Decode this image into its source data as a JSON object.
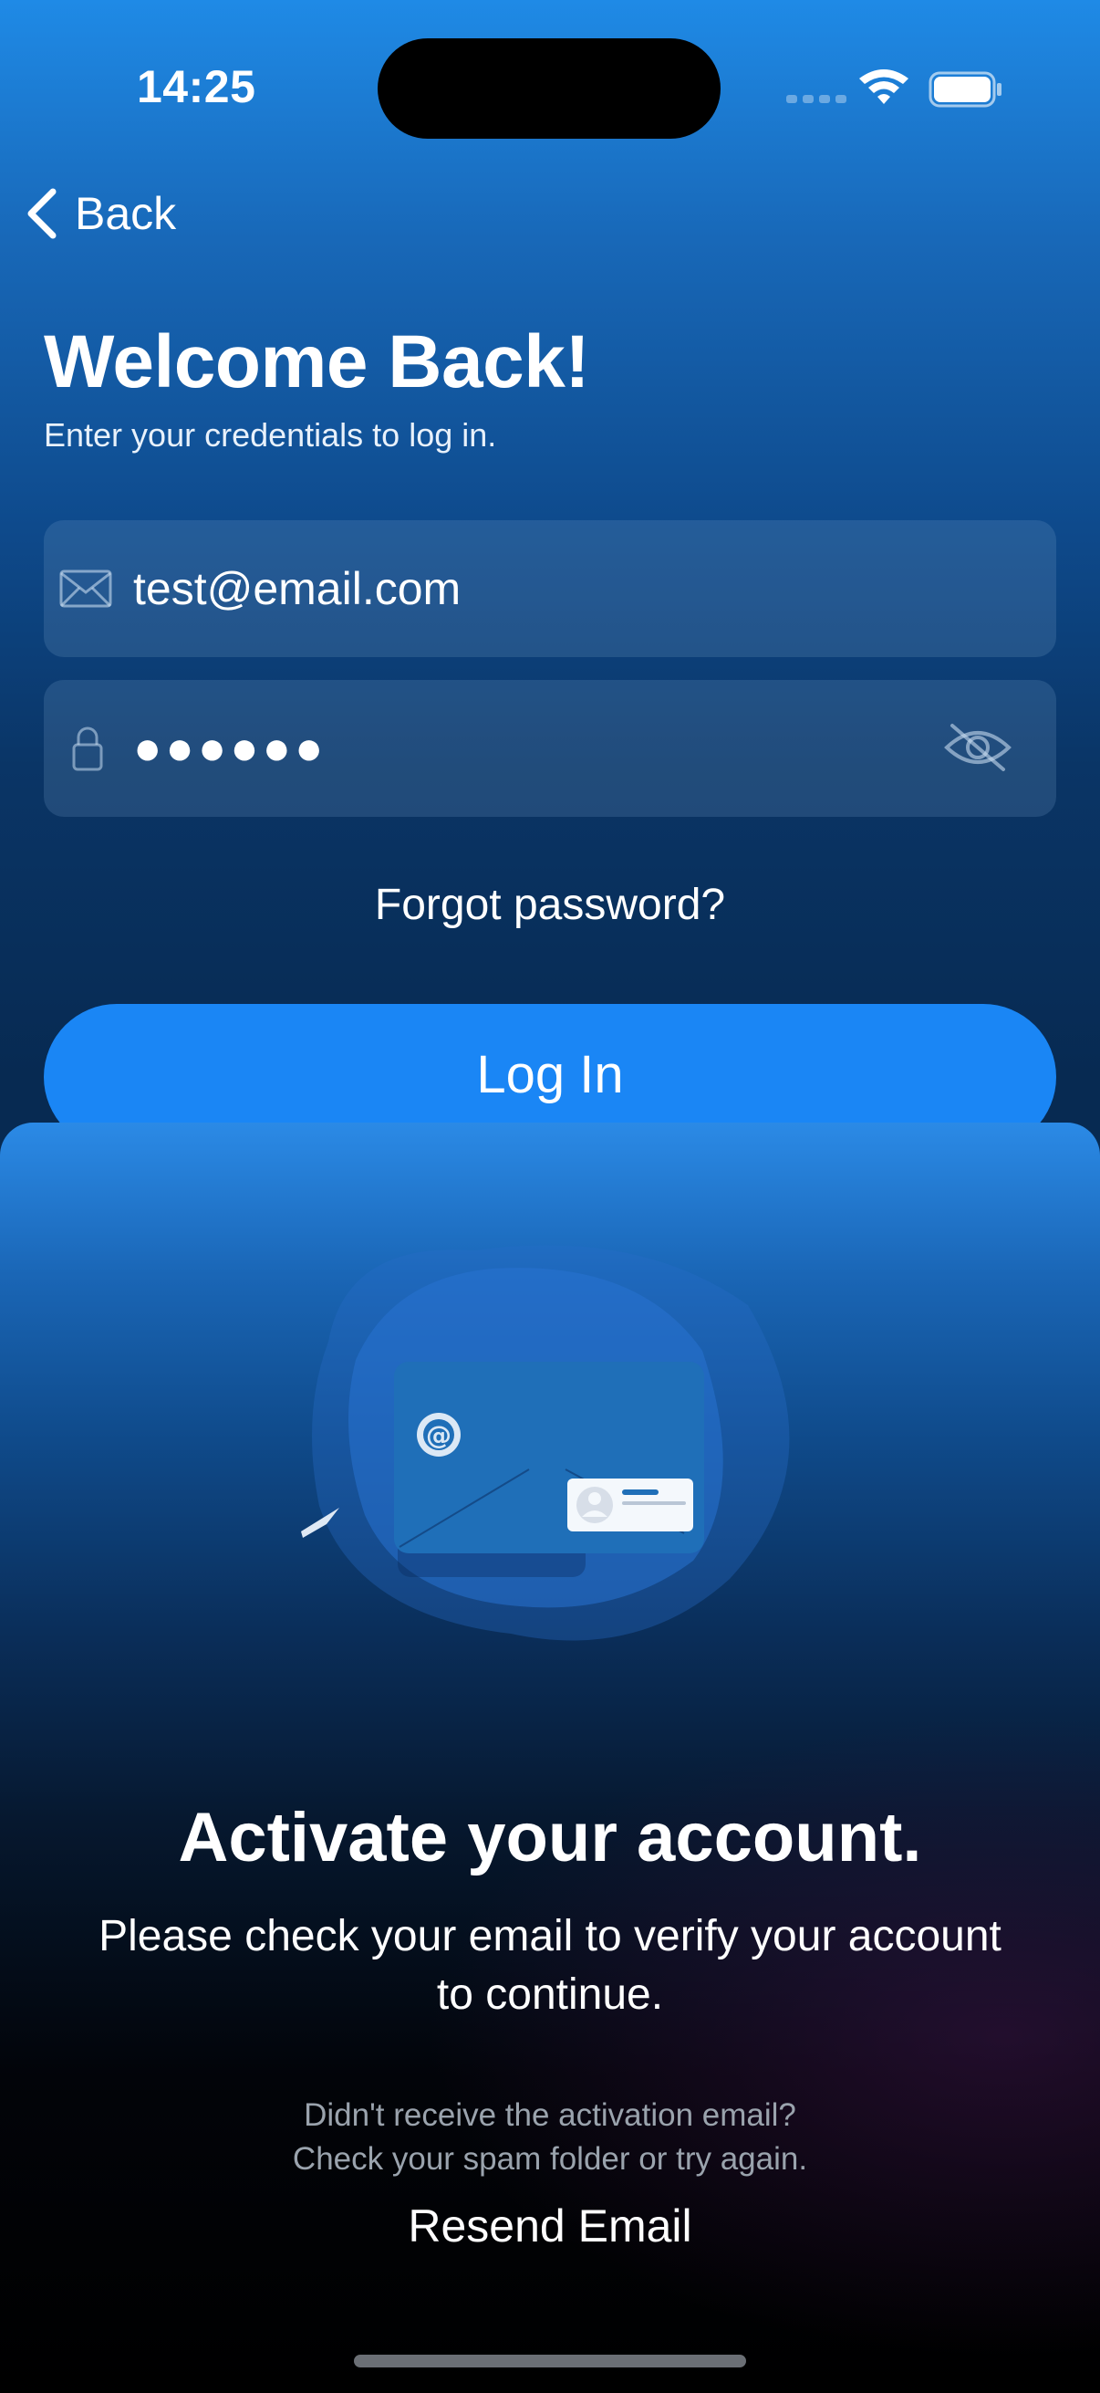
{
  "status_bar": {
    "time": "14:25"
  },
  "nav": {
    "back_label": "Back"
  },
  "login": {
    "title": "Welcome Back!",
    "subtitle": "Enter your credentials to log in.",
    "email_value": "test@email.com",
    "password_masked": "●●●●●●",
    "forgot_label": "Forgot password?",
    "login_label": "Log In"
  },
  "sheet": {
    "title": "Activate your account.",
    "body_line1": "Please check your email to verify your account",
    "body_line2": "to continue.",
    "hint_line1": "Didn't receive the activation email?",
    "hint_line2": "Check your spam folder or try again.",
    "resend_label": "Resend Email"
  },
  "colors": {
    "primary_button": "#1a86f5",
    "background_top": "#1f8ae6",
    "hint_text": "#9aa3ad"
  },
  "icons": {
    "back": "chevron-left-icon",
    "email": "envelope-icon",
    "password": "lock-icon",
    "visibility": "eye-slash-icon",
    "wifi": "wifi-icon",
    "battery": "battery-icon"
  }
}
